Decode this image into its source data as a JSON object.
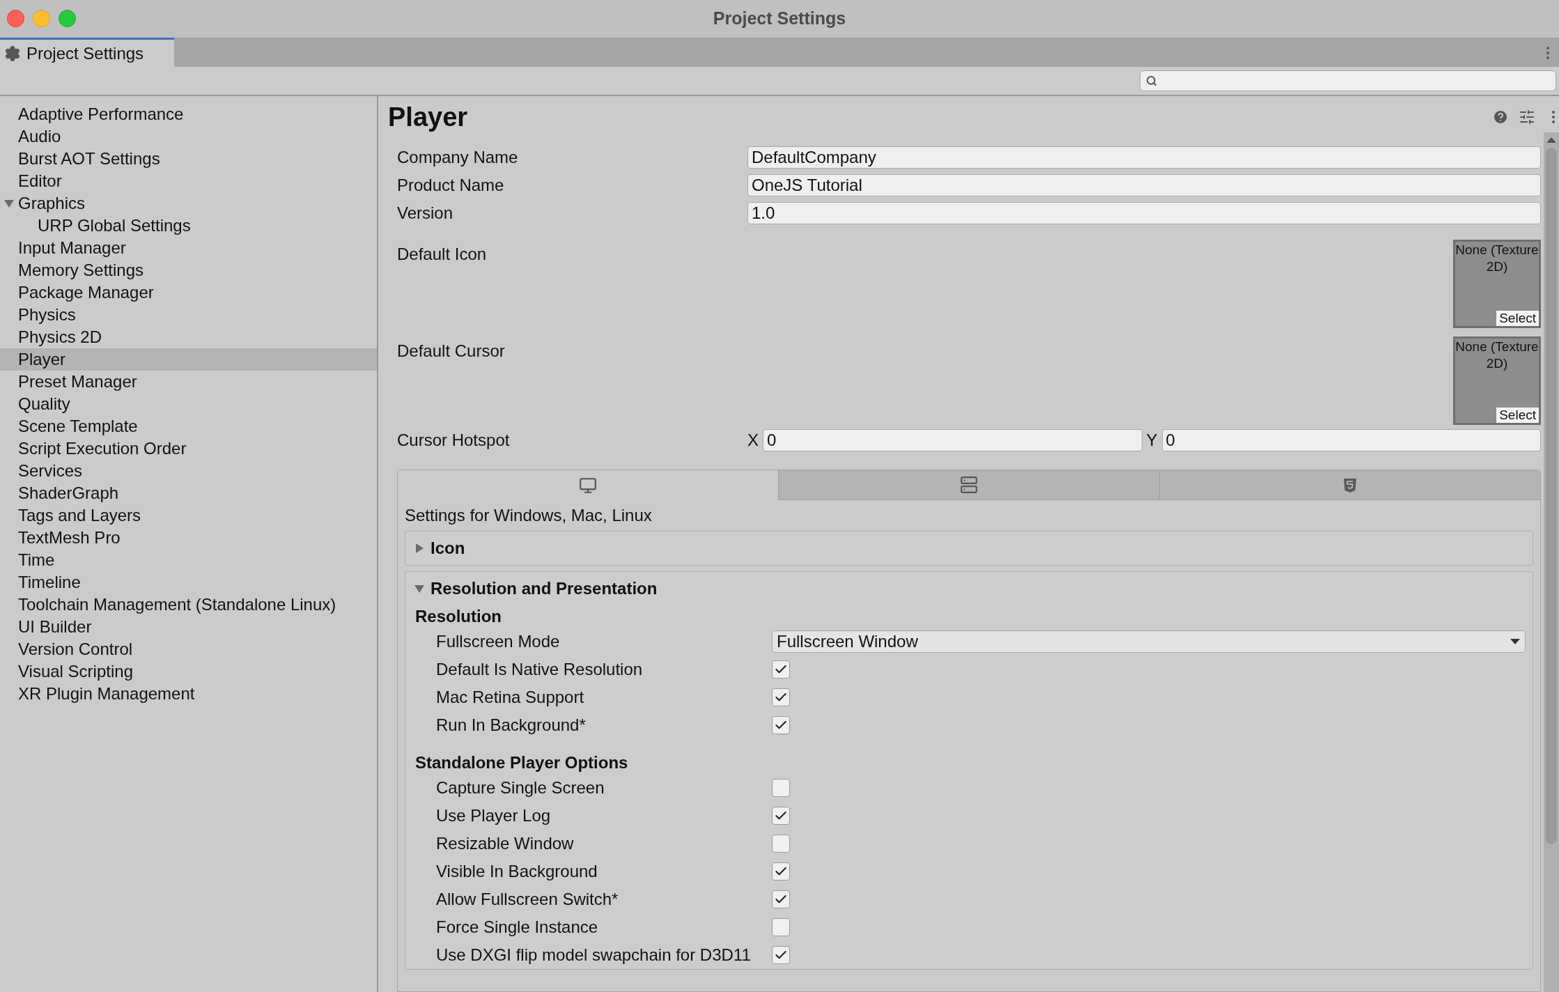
{
  "window": {
    "title": "Project Settings"
  },
  "window_tab": {
    "label": "Project Settings",
    "selected": true
  },
  "sidebar": {
    "items": [
      {
        "label": "Adaptive Performance",
        "selected": false
      },
      {
        "label": "Audio",
        "selected": false
      },
      {
        "label": "Burst AOT Settings",
        "selected": false
      },
      {
        "label": "Editor",
        "selected": false
      },
      {
        "label": "Graphics",
        "selected": false,
        "expanded": true,
        "children": [
          {
            "label": "URP Global Settings",
            "selected": false
          }
        ]
      },
      {
        "label": "Input Manager",
        "selected": false
      },
      {
        "label": "Memory Settings",
        "selected": false
      },
      {
        "label": "Package Manager",
        "selected": false
      },
      {
        "label": "Physics",
        "selected": false
      },
      {
        "label": "Physics 2D",
        "selected": false
      },
      {
        "label": "Player",
        "selected": true
      },
      {
        "label": "Preset Manager",
        "selected": false
      },
      {
        "label": "Quality",
        "selected": false
      },
      {
        "label": "Scene Template",
        "selected": false
      },
      {
        "label": "Script Execution Order",
        "selected": false
      },
      {
        "label": "Services",
        "selected": false
      },
      {
        "label": "ShaderGraph",
        "selected": false
      },
      {
        "label": "Tags and Layers",
        "selected": false
      },
      {
        "label": "TextMesh Pro",
        "selected": false
      },
      {
        "label": "Time",
        "selected": false
      },
      {
        "label": "Timeline",
        "selected": false
      },
      {
        "label": "Toolchain Management (Standalone Linux)",
        "selected": false
      },
      {
        "label": "UI Builder",
        "selected": false
      },
      {
        "label": "Version Control",
        "selected": false
      },
      {
        "label": "Visual Scripting",
        "selected": false
      },
      {
        "label": "XR Plugin Management",
        "selected": false
      }
    ]
  },
  "panel": {
    "title": "Player",
    "fields": [
      {
        "label": "Company Name",
        "value": "DefaultCompany"
      },
      {
        "label": "Product Name",
        "value": "OneJS Tutorial"
      },
      {
        "label": "Version",
        "value": "1.0"
      }
    ],
    "object_fields": [
      {
        "label": "Default Icon",
        "value": "None (Texture 2D)",
        "button": "Select"
      },
      {
        "label": "Default Cursor",
        "value": "None (Texture 2D)",
        "button": "Select"
      }
    ],
    "cursor_hotspot": {
      "label": "Cursor Hotspot",
      "x_label": "X",
      "x_value": "0",
      "y_label": "Y",
      "y_value": "0"
    },
    "platform_tabs": [
      {
        "kind": "desktop",
        "selected": true
      },
      {
        "kind": "server",
        "selected": false
      },
      {
        "kind": "webgl",
        "selected": false
      }
    ],
    "caption": "Settings for Windows, Mac, Linux",
    "sections": [
      {
        "title": "Icon",
        "expanded": false
      },
      {
        "title": "Resolution and Presentation",
        "expanded": true,
        "groups": [
          {
            "title": "Resolution",
            "rows": [
              {
                "kind": "dropdown",
                "label": "Fullscreen Mode",
                "value": "Fullscreen Window"
              },
              {
                "kind": "checkbox",
                "label": "Default Is Native Resolution",
                "checked": true
              },
              {
                "kind": "checkbox",
                "label": "Mac Retina Support",
                "checked": true
              },
              {
                "kind": "checkbox",
                "label": "Run In Background*",
                "checked": true
              }
            ]
          },
          {
            "title": "Standalone Player Options",
            "rows": [
              {
                "kind": "checkbox",
                "label": "Capture Single Screen",
                "checked": false
              },
              {
                "kind": "checkbox",
                "label": "Use Player Log",
                "checked": true
              },
              {
                "kind": "checkbox",
                "label": "Resizable Window",
                "checked": false
              },
              {
                "kind": "checkbox",
                "label": "Visible In Background",
                "checked": true
              },
              {
                "kind": "checkbox",
                "label": "Allow Fullscreen Switch*",
                "checked": true
              },
              {
                "kind": "checkbox",
                "label": "Force Single Instance",
                "checked": false
              },
              {
                "kind": "checkbox",
                "label": "Use DXGI flip model swapchain for D3D11",
                "checked": true
              }
            ]
          }
        ]
      }
    ]
  }
}
